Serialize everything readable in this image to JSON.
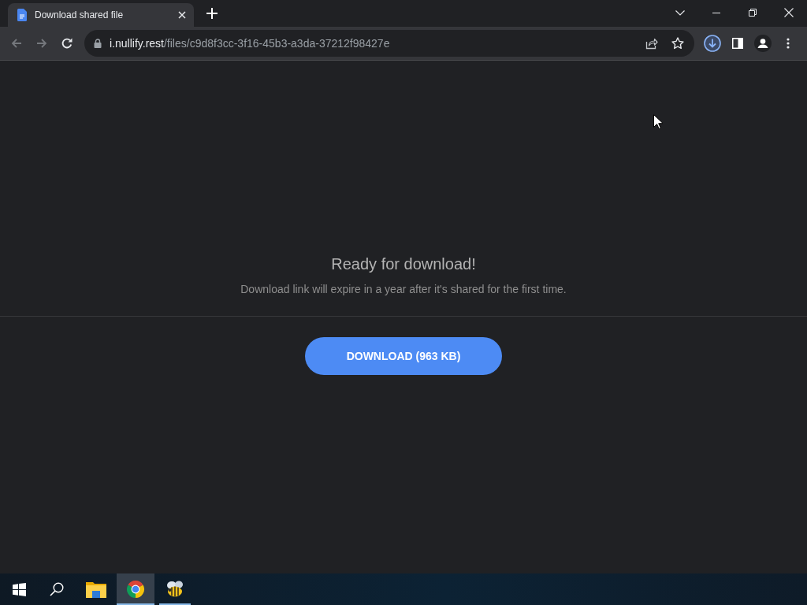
{
  "window": {
    "tabs": [
      {
        "title": "Download shared file",
        "selected": true
      }
    ]
  },
  "toolbar": {
    "nav_buttons": [
      {
        "kind": "back",
        "disabled": true
      },
      {
        "kind": "forward",
        "disabled": true
      },
      {
        "kind": "reload",
        "disabled": false
      }
    ],
    "address_bar": {
      "host": "i.nullify.rest",
      "path": "/files/c9d8f3cc-3f16-45b3-a3da-37212f98427e"
    }
  },
  "page": {
    "title": "Ready for download!",
    "subtitle": "Download link will expire in a year after it's shared for the first time.",
    "download_button": "DOWNLOAD (963 KB)"
  },
  "taskbar": {
    "apps": [
      {
        "kind": "folder",
        "running": false,
        "selected": false
      },
      {
        "kind": "browser",
        "running": true,
        "selected": true
      },
      {
        "kind": "bee",
        "running": true,
        "selected": false
      }
    ]
  }
}
